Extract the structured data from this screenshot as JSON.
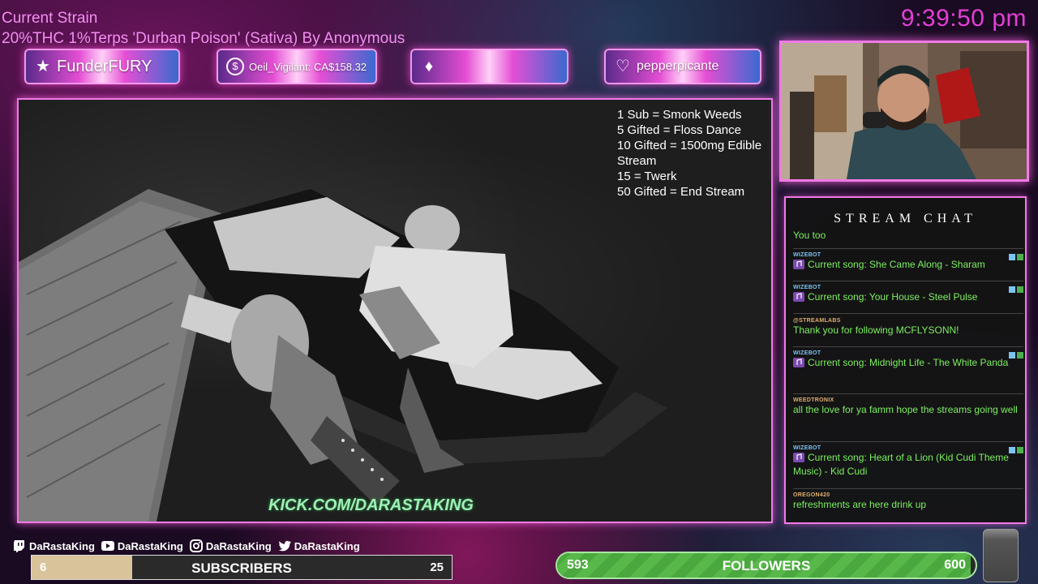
{
  "strain": {
    "title": "Current Strain",
    "detail": "20%THC 1%Terps 'Durban Poison' (Sativa) By Anonymous"
  },
  "clock": "9:39:50 pm",
  "alerts": [
    {
      "icon": "star-icon",
      "label": "FunderFURY"
    },
    {
      "icon": "dollar-icon",
      "label": "Oeil_Vigilant: CA$158.32"
    },
    {
      "icon": "diamond-icon",
      "label": ""
    },
    {
      "icon": "heart-icon",
      "label": "pepperpicante"
    }
  ],
  "goals": [
    "1 Sub = Smonk Weeds",
    "5 Gifted = Floss Dance",
    "10 Gifted = 1500mg Edible",
    "Stream",
    "15 = Twerk",
    "50 Gifted = End Stream"
  ],
  "kick_link": "KICK.COM/DARASTAKING",
  "chat": {
    "title": "STREAM CHAT",
    "messages": [
      {
        "user": "",
        "text": "You too",
        "bot": false
      },
      {
        "user": "WIZEBOT",
        "text": "Current song: She Came Along - Sharam",
        "bot": true
      },
      {
        "user": "WIZEBOT",
        "text": "Current song: Your House - Steel Pulse",
        "bot": true
      },
      {
        "user": "@STREAMLABS",
        "text": "Thank you for following MCFLYSONN!",
        "bot": false
      },
      {
        "user": "WIZEBOT",
        "text": "Current song: Midnight Life - The White Panda",
        "bot": true
      },
      {
        "user": "WEEDTRONIX",
        "text": "all the love for ya famm hope the streams going well",
        "bot": false
      },
      {
        "user": "WIZEBOT",
        "text": "Current song: Heart of a Lion (Kid Cudi Theme Music) - Kid Cudi",
        "bot": true
      },
      {
        "user": "OREGON420",
        "text": "refreshments are here drink up",
        "bot": false
      }
    ]
  },
  "socials": [
    {
      "icon": "twitch-icon",
      "handle": "DaRastaKing"
    },
    {
      "icon": "youtube-icon",
      "handle": "DaRastaKing"
    },
    {
      "icon": "instagram-icon",
      "handle": "DaRastaKing"
    },
    {
      "icon": "twitter-icon",
      "handle": "DaRastaKing"
    }
  ],
  "subscribers": {
    "label": "SUBSCRIBERS",
    "current": "6",
    "goal": "25",
    "progress": 0.24
  },
  "followers": {
    "label": "FOLLOWERS",
    "current": "593",
    "goal": "600",
    "progress": 0.988
  },
  "colors": {
    "accent_pink": "#f07ae6",
    "clock_pink": "#e43fd6",
    "chat_text_green": "#7cf060",
    "follower_green": "#4aa83e",
    "sub_fill": "#d8c39a"
  }
}
